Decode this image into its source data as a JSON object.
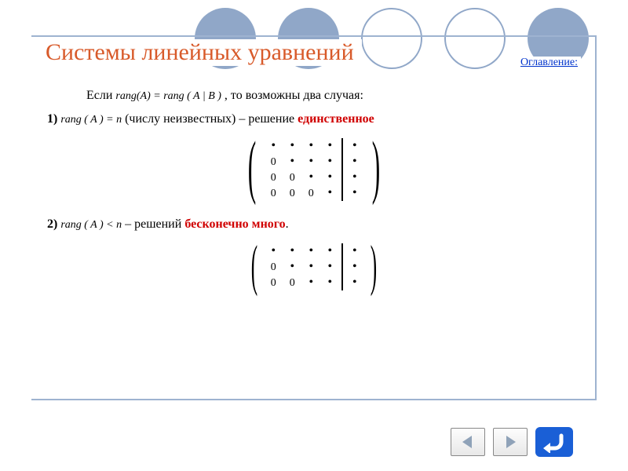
{
  "title": "Системы линейных уравнений",
  "tocLink": "Оглавление:",
  "intro": {
    "prefix": "Если",
    "rang": "rang(A) = rang ( A | B )",
    "suffix": ", то возможны два случая:"
  },
  "case1": {
    "num": "1)",
    "rang": "rang ( A ) = n",
    "descr": "(числу неизвестных) – решение",
    "red": "единственное"
  },
  "case2": {
    "num": "2)",
    "rang": "rang ( A ) < n",
    "descr": "– решений",
    "red": "бесконечно много",
    "dot": "."
  },
  "matrix1": {
    "rows": [
      [
        "•",
        "•",
        "•",
        "•",
        "|",
        "•"
      ],
      [
        "0",
        "•",
        "•",
        "•",
        "|",
        "•"
      ],
      [
        "0",
        "0",
        "•",
        "•",
        "|",
        "•"
      ],
      [
        "0",
        "0",
        "0",
        "•",
        "|",
        "•"
      ]
    ]
  },
  "matrix2": {
    "rows": [
      [
        "•",
        "•",
        "•",
        "•",
        "|",
        "•"
      ],
      [
        "0",
        "•",
        "•",
        "•",
        "|",
        "•"
      ],
      [
        "0",
        "0",
        "•",
        "•",
        "|",
        "•"
      ]
    ]
  },
  "colors": {
    "accent": "#d85a2a",
    "circle": "#90a7c8",
    "link": "#0033cc",
    "red": "#d00000",
    "navBlue": "#1a5fd6",
    "navArrow": "#7a8aa0"
  }
}
